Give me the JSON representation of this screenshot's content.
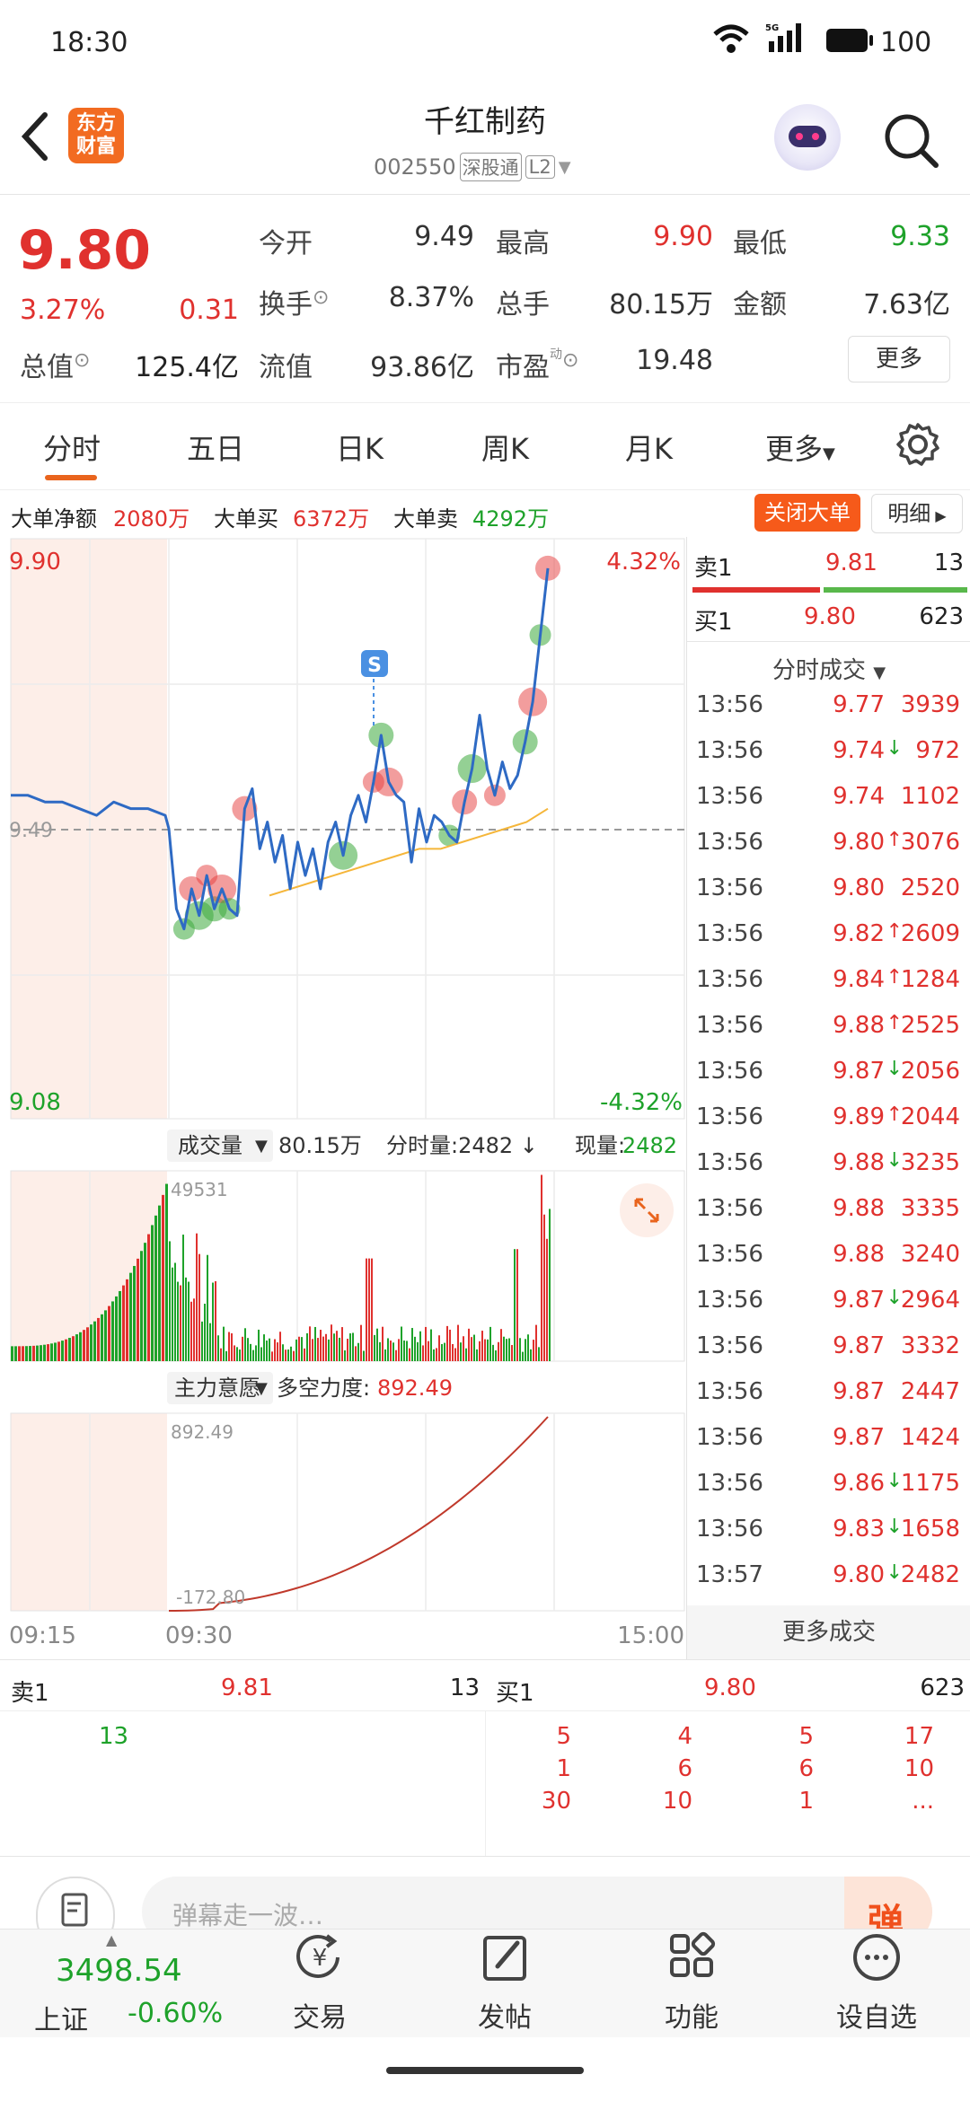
{
  "status_bar": {
    "time": "18:30",
    "battery": "100",
    "signal_label": "5G"
  },
  "header": {
    "app_logo": [
      "东方",
      "财富"
    ],
    "stock_name": "千红制药",
    "stock_code": "002550",
    "badge_sgt": "深股通",
    "badge_l2": "L2"
  },
  "quote": {
    "price": "9.80",
    "change_pct": "3.27%",
    "change_amt": "0.31",
    "total_value_label": "总值",
    "total_value": "125.4亿",
    "fields": [
      {
        "label": "今开",
        "value": "9.49"
      },
      {
        "label": "最高",
        "value": "9.90"
      },
      {
        "label": "最低",
        "value": "9.33"
      },
      {
        "label": "换手",
        "value": "8.37%"
      },
      {
        "label": "总手",
        "value": "80.15万"
      },
      {
        "label": "金额",
        "value": "7.63亿"
      },
      {
        "label": "流值",
        "value": "93.86亿"
      },
      {
        "label": "市盈",
        "value": "19.48"
      }
    ],
    "pe_sup": "动",
    "more_button": "更多"
  },
  "tabs": [
    "分时",
    "五日",
    "日K",
    "周K",
    "月K",
    "更多"
  ],
  "big_order": {
    "net_label": "大单净额",
    "net_value": "2080万",
    "buy_label": "大单买",
    "buy_value": "6372万",
    "sell_label": "大单卖",
    "sell_value": "4292万",
    "close_button": "关闭大单",
    "detail_button": "明细"
  },
  "chart_labels": {
    "price_high": "9.90",
    "price_low": "9.08",
    "price_mid": "9.49",
    "pct_high": "4.32%",
    "pct_low": "-4.32%",
    "volume_selector": "成交量",
    "volume_total": "80.15万",
    "minute_volume": "分时量:2482 ↓",
    "current_volume_label": "现量:",
    "current_volume": "2482",
    "volume_max": "49531",
    "intent_selector": "主力意愿",
    "power_label": "多空力度:",
    "power_value": "892.49",
    "intent_max": "892.49",
    "intent_min": "-172.80",
    "time_start": "09:15",
    "time_open": "09:30",
    "time_end": "15:00",
    "s_marker": "S"
  },
  "chart_data": {
    "type": "line",
    "title": "",
    "ylim": [
      9.08,
      9.9
    ],
    "prev_close": 9.49,
    "series": [
      {
        "name": "",
        "values": [
          9.54,
          9.54,
          9.53,
          9.53,
          9.52,
          9.51,
          9.53,
          9.52,
          9.52,
          9.51,
          9.49,
          9.37,
          9.34,
          9.4,
          9.36,
          9.42,
          9.37,
          9.4,
          9.37,
          9.36,
          9.52,
          9.55,
          9.46,
          9.5,
          9.44,
          9.48,
          9.4,
          9.47,
          9.42,
          9.46,
          9.4,
          9.47,
          9.5,
          9.45,
          9.51,
          9.54,
          9.5,
          9.56,
          9.63,
          9.56,
          9.54,
          9.53,
          9.44,
          9.52,
          9.47,
          9.51,
          9.5,
          9.48,
          9.47,
          9.53,
          9.58,
          9.66,
          9.58,
          9.54,
          9.59,
          9.55,
          9.57,
          9.62,
          9.68,
          9.78,
          9.88
        ]
      },
      {
        "name": "",
        "values": [
          9.39,
          9.4,
          9.41,
          9.42,
          9.43,
          9.44,
          9.45,
          9.46,
          9.46,
          9.47,
          9.48,
          9.49,
          9.5,
          9.52
        ]
      }
    ],
    "volume_ylim": [
      0,
      49531
    ],
    "intent_ylim": [
      -172.8,
      892.49
    ]
  },
  "order_book_side": {
    "sell1_label": "卖1",
    "sell1_price": "9.81",
    "sell1_vol": "13",
    "buy1_label": "买1",
    "buy1_price": "9.80",
    "buy1_vol": "623"
  },
  "minute_trades": {
    "title": "分时成交",
    "rows": [
      {
        "time": "13:56",
        "price": "9.77",
        "vol": "3939",
        "dir": ""
      },
      {
        "time": "13:56",
        "price": "9.74",
        "vol": "972",
        "dir": "down"
      },
      {
        "time": "13:56",
        "price": "9.74",
        "vol": "1102",
        "dir": ""
      },
      {
        "time": "13:56",
        "price": "9.80",
        "vol": "3076",
        "dir": "up"
      },
      {
        "time": "13:56",
        "price": "9.80",
        "vol": "2520",
        "dir": ""
      },
      {
        "time": "13:56",
        "price": "9.82",
        "vol": "2609",
        "dir": "up"
      },
      {
        "time": "13:56",
        "price": "9.84",
        "vol": "1284",
        "dir": "up"
      },
      {
        "time": "13:56",
        "price": "9.88",
        "vol": "2525",
        "dir": "up"
      },
      {
        "time": "13:56",
        "price": "9.87",
        "vol": "2056",
        "dir": "down"
      },
      {
        "time": "13:56",
        "price": "9.89",
        "vol": "2044",
        "dir": "up"
      },
      {
        "time": "13:56",
        "price": "9.88",
        "vol": "3235",
        "dir": "down"
      },
      {
        "time": "13:56",
        "price": "9.88",
        "vol": "3335",
        "dir": ""
      },
      {
        "time": "13:56",
        "price": "9.88",
        "vol": "3240",
        "dir": ""
      },
      {
        "time": "13:56",
        "price": "9.87",
        "vol": "2964",
        "dir": "down"
      },
      {
        "time": "13:56",
        "price": "9.87",
        "vol": "3332",
        "dir": ""
      },
      {
        "time": "13:56",
        "price": "9.87",
        "vol": "2447",
        "dir": ""
      },
      {
        "time": "13:56",
        "price": "9.87",
        "vol": "1424",
        "dir": ""
      },
      {
        "time": "13:56",
        "price": "9.86",
        "vol": "1175",
        "dir": "down"
      },
      {
        "time": "13:56",
        "price": "9.83",
        "vol": "1658",
        "dir": "down"
      },
      {
        "time": "13:57",
        "price": "9.80",
        "vol": "2482",
        "dir": "down"
      }
    ],
    "more_button": "更多成交"
  },
  "order_book": {
    "sell1_label": "卖1",
    "sell1_price": "9.81",
    "sell1_vol": "13",
    "buy1_label": "买1",
    "buy1_price": "9.80",
    "buy1_vol": "623",
    "sell_queue": [
      "13"
    ],
    "buy_queue": [
      [
        "5",
        "4",
        "5",
        "17"
      ],
      [
        "1",
        "6",
        "6",
        "10"
      ],
      [
        "30",
        "10",
        "1",
        "..."
      ]
    ]
  },
  "comment": {
    "placeholder": "弹幕走一波…",
    "button": "弹"
  },
  "bottom_nav": {
    "index_value": "3498.54",
    "index_name": "上证",
    "index_change": "-0.60%",
    "items": [
      "交易",
      "发帖",
      "功能",
      "设自选"
    ]
  }
}
